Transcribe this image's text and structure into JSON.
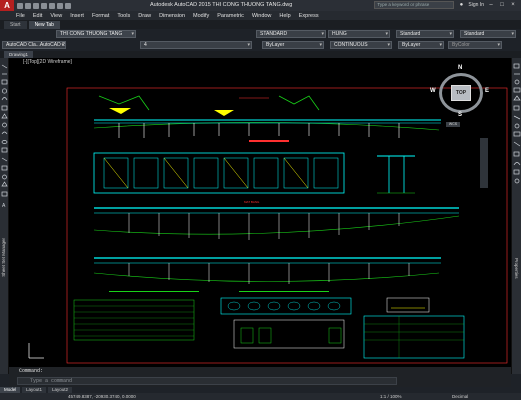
{
  "window": {
    "title": "Autodesk AutoCAD 2015   THI CONG THUONG TANG.dwg",
    "search_placeholder": "Type a keyword or phrase",
    "signin_label": "Sign In",
    "logo_letter": "A"
  },
  "menu": [
    "File",
    "Edit",
    "View",
    "Insert",
    "Format",
    "Tools",
    "Draw",
    "Dimension",
    "Modify",
    "Parametric",
    "Window",
    "Help",
    "Express"
  ],
  "file_tabs": [
    "Start",
    "New Tab"
  ],
  "doc_tab": "THI CONG THUONG TANG",
  "props": {
    "workspace": "AutoCAD Cla...AutoCAD 200",
    "layer": "4",
    "text_style": "STANDARD",
    "dim_style": "HUNG",
    "table_style": "Standard",
    "mleader_style": "Standard",
    "color": "ByLayer",
    "linetype": "CONTINUOUS",
    "lineweight": "ByLayer",
    "plotstyle": "ByColor"
  },
  "drawing_tab": "Drawing1",
  "viewport_label": "[-][Top][2D Wireframe]",
  "viewcube": {
    "top": "TOP",
    "n": "N",
    "s": "S",
    "e": "E",
    "w": "W",
    "wcs": "WCS"
  },
  "palettes": {
    "left": "Sheet Set Manager",
    "right": "Properties"
  },
  "command": {
    "history": "Command:",
    "placeholder": "Type a command"
  },
  "layouts": [
    "Model",
    "Layout1",
    "Layout2"
  ],
  "status": {
    "coords": "45749.8387, -20930.3740, 0.0000",
    "model": "MODEL",
    "scale": "1:1 / 100%",
    "units": "Decimal"
  },
  "colors": {
    "accent_red": "#b51f1f",
    "drawing_cyan": "#00ffff",
    "drawing_green": "#19d219",
    "drawing_yellow": "#ffff00",
    "drawing_red": "#ff2020"
  }
}
